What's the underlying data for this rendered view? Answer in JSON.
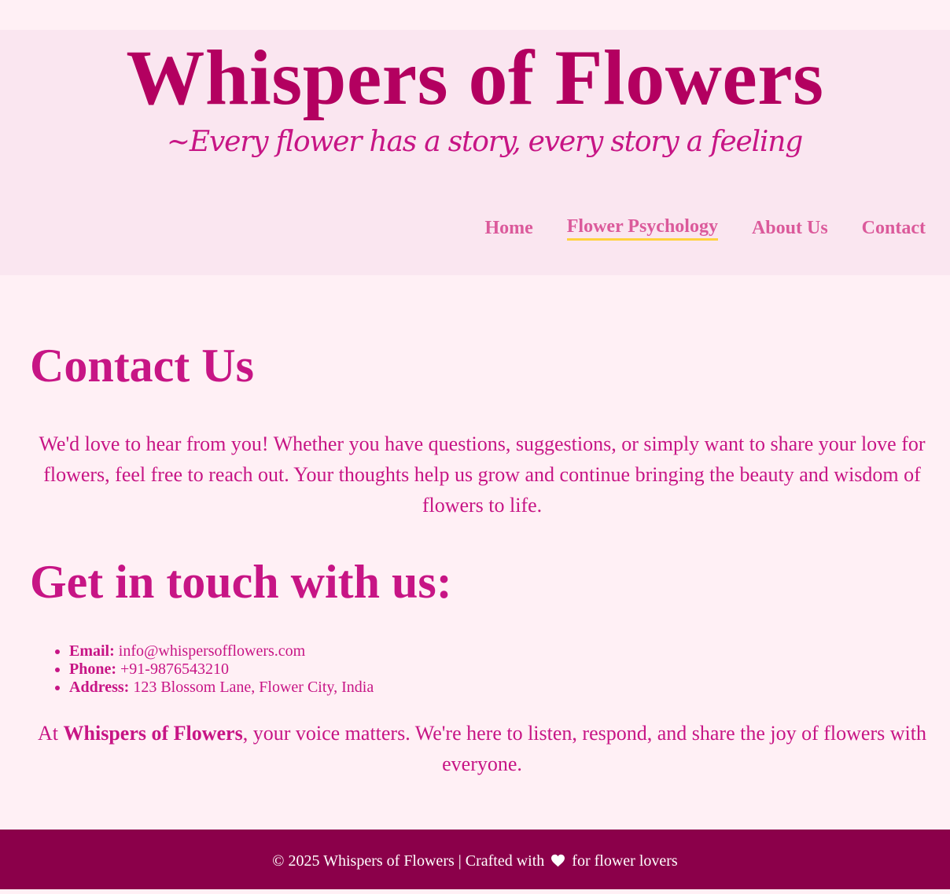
{
  "header": {
    "title": "Whispers of Flowers",
    "tagline": "~Every flower has a story, every story a feeling"
  },
  "nav": {
    "items": [
      {
        "label": "Home"
      },
      {
        "label": "Flower Psychology",
        "active": true
      },
      {
        "label": "About Us"
      },
      {
        "label": "Contact"
      }
    ]
  },
  "main": {
    "heading": "Contact Us",
    "intro": "We'd love to hear from you! Whether you have questions, suggestions, or simply want to share your love for flowers, feel free to reach out. Your thoughts help us grow and continue bringing the beauty and wisdom of flowers to life.",
    "contact_heading": "Get in touch with us:",
    "contacts": [
      {
        "label": "Email:",
        "value": "info@whispersofflowers.com"
      },
      {
        "label": "Phone:",
        "value": "+91-9876543210"
      },
      {
        "label": "Address:",
        "value": "123 Blossom Lane, Flower City, India"
      }
    ],
    "closing": {
      "prefix": "At ",
      "brand": "Whispers of Flowers",
      "suffix": ", your voice matters. We're here to listen, respond, and share the joy of flowers with everyone."
    }
  },
  "footer": {
    "prefix": "© 2025 Whispers of Flowers | Crafted with",
    "heart_icon": "heart-icon",
    "suffix": "for flower lovers"
  },
  "colors": {
    "page_bg": "#fff0f5",
    "header_bg": "#fae6f0",
    "title": "#b30060",
    "accent": "#c71585",
    "nav_link": "#db5a9b",
    "active_underline": "#ffd23f",
    "footer_bg": "#8b004a",
    "footer_text": "#ffffff"
  }
}
